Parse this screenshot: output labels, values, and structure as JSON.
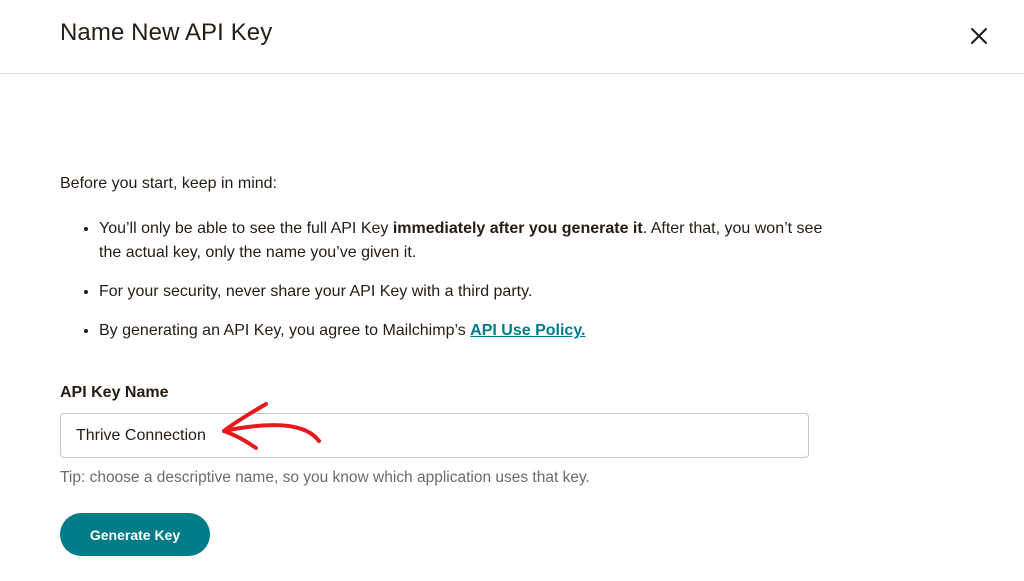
{
  "dialog": {
    "title": "Name New API Key",
    "close_icon": "close-icon"
  },
  "intro_text": "Before you start, keep in mind:",
  "notes": [
    {
      "before": "You’ll only be able to see the full API Key ",
      "bold": "immediately after you generate it",
      "after": ". After that, you won’t see the actual key, only the name you’ve given it."
    },
    {
      "text": "For your security, never share your API Key with a third party."
    },
    {
      "before": "By generating an API Key, you agree to Mailchimp’s ",
      "link": "API Use Policy."
    }
  ],
  "form": {
    "label": "API Key Name",
    "value": "Thrive Connection",
    "tip": "Tip: choose a descriptive name, so you know which application uses that key."
  },
  "actions": {
    "generate_label": "Generate Key"
  },
  "colors": {
    "accent": "#007c89",
    "annotation": "#e8191d",
    "text": "#241c15",
    "muted": "#6b6b6b",
    "border": "#c8c8c8"
  }
}
